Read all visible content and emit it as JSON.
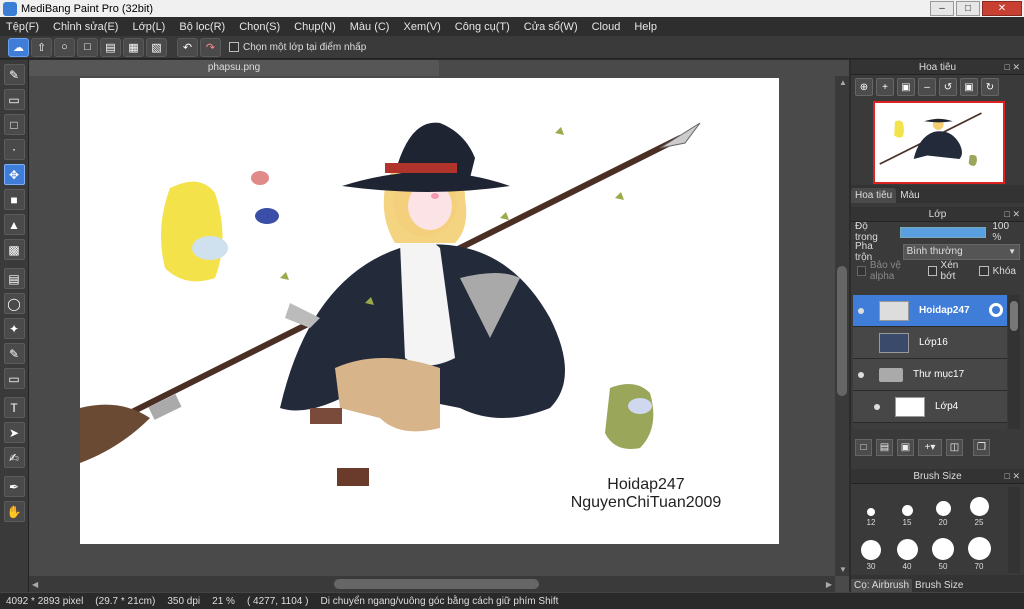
{
  "window": {
    "title": "MediBang Paint Pro (32bit)"
  },
  "menu": [
    "Tệp(F)",
    "Chỉnh sửa(E)",
    "Lớp(L)",
    "Bộ lọc(R)",
    "Chọn(S)",
    "Chụp(N)",
    "Màu (C)",
    "Xem(V)",
    "Công cụ(T)",
    "Cửa sổ(W)",
    "Cloud",
    "Help"
  ],
  "toolbar": {
    "select_layer_label": "Chọn một lớp tại điểm nhấp"
  },
  "document": {
    "tab": "phapsu.png",
    "signature_line1": "Hoidap247",
    "signature_line2": "NguyenChiTuan2009"
  },
  "statusbar": {
    "size_px": "4092 * 2893 pixel",
    "size_cm": "(29.7 * 21cm)",
    "dpi": "350 dpi",
    "zoom": "21 %",
    "coords": "( 4277, 1104 )",
    "hint": "Di chuyển ngang/vuông góc bằng cách giữ phím Shift"
  },
  "navigator": {
    "title": "Hoa tiêu",
    "tabs": [
      "Hoa tiêu",
      "Màu"
    ]
  },
  "layers": {
    "title": "Lớp",
    "opacity_label": "Độ trong",
    "opacity_value": "100 %",
    "opacity": 1.0,
    "blend_label": "Pha trộn",
    "blend_value": "Bình thường",
    "protect_alpha": "Bảo vệ alpha",
    "clipping": "Xén bớt",
    "lock": "Khóa",
    "items": [
      {
        "name": "Hoidap247",
        "selected": true
      },
      {
        "name": "Lớp16",
        "selected": false
      },
      {
        "name": "Thư mục17",
        "selected": false
      },
      {
        "name": "Lớp4",
        "selected": false
      }
    ]
  },
  "brush": {
    "title": "Brush Size",
    "sizes": [
      "12",
      "15",
      "20",
      "25",
      "30",
      "40",
      "50",
      "70"
    ],
    "tabs": [
      "Cọ: Airbrush",
      "Brush Size"
    ]
  },
  "colors": {
    "accent": "#3f7dd8",
    "panel": "#3a3a3a",
    "nav_frame": "#dd2222"
  }
}
